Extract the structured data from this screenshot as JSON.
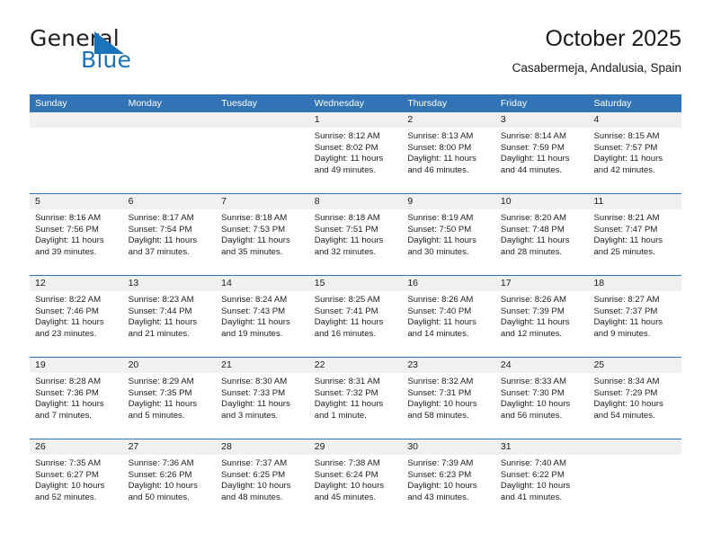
{
  "brand": {
    "name_part1": "General",
    "name_part2": "Blue",
    "triangle_color": "#1a74bb",
    "text_color": "#231f20"
  },
  "header": {
    "title": "October 2025",
    "subtitle": "Casabermeja, Andalusia, Spain"
  },
  "theme": {
    "accent": "#3273b5",
    "day_strip": "#f0f0f0",
    "text": "#1a1a1a"
  },
  "weekdays": [
    "Sunday",
    "Monday",
    "Tuesday",
    "Wednesday",
    "Thursday",
    "Friday",
    "Saturday"
  ],
  "labels": {
    "sunrise": "Sunrise:",
    "sunset": "Sunset:",
    "daylight": "Daylight:"
  },
  "weeks": [
    [
      {
        "day": "",
        "sunrise": "",
        "sunset": "",
        "daylight": "",
        "empty": true
      },
      {
        "day": "",
        "sunrise": "",
        "sunset": "",
        "daylight": "",
        "empty": true
      },
      {
        "day": "",
        "sunrise": "",
        "sunset": "",
        "daylight": "",
        "empty": true
      },
      {
        "day": "1",
        "sunrise": "Sunrise: 8:12 AM",
        "sunset": "Sunset: 8:02 PM",
        "daylight": "Daylight: 11 hours and 49 minutes."
      },
      {
        "day": "2",
        "sunrise": "Sunrise: 8:13 AM",
        "sunset": "Sunset: 8:00 PM",
        "daylight": "Daylight: 11 hours and 46 minutes."
      },
      {
        "day": "3",
        "sunrise": "Sunrise: 8:14 AM",
        "sunset": "Sunset: 7:59 PM",
        "daylight": "Daylight: 11 hours and 44 minutes."
      },
      {
        "day": "4",
        "sunrise": "Sunrise: 8:15 AM",
        "sunset": "Sunset: 7:57 PM",
        "daylight": "Daylight: 11 hours and 42 minutes."
      }
    ],
    [
      {
        "day": "5",
        "sunrise": "Sunrise: 8:16 AM",
        "sunset": "Sunset: 7:56 PM",
        "daylight": "Daylight: 11 hours and 39 minutes."
      },
      {
        "day": "6",
        "sunrise": "Sunrise: 8:17 AM",
        "sunset": "Sunset: 7:54 PM",
        "daylight": "Daylight: 11 hours and 37 minutes."
      },
      {
        "day": "7",
        "sunrise": "Sunrise: 8:18 AM",
        "sunset": "Sunset: 7:53 PM",
        "daylight": "Daylight: 11 hours and 35 minutes."
      },
      {
        "day": "8",
        "sunrise": "Sunrise: 8:18 AM",
        "sunset": "Sunset: 7:51 PM",
        "daylight": "Daylight: 11 hours and 32 minutes."
      },
      {
        "day": "9",
        "sunrise": "Sunrise: 8:19 AM",
        "sunset": "Sunset: 7:50 PM",
        "daylight": "Daylight: 11 hours and 30 minutes."
      },
      {
        "day": "10",
        "sunrise": "Sunrise: 8:20 AM",
        "sunset": "Sunset: 7:48 PM",
        "daylight": "Daylight: 11 hours and 28 minutes."
      },
      {
        "day": "11",
        "sunrise": "Sunrise: 8:21 AM",
        "sunset": "Sunset: 7:47 PM",
        "daylight": "Daylight: 11 hours and 25 minutes."
      }
    ],
    [
      {
        "day": "12",
        "sunrise": "Sunrise: 8:22 AM",
        "sunset": "Sunset: 7:46 PM",
        "daylight": "Daylight: 11 hours and 23 minutes."
      },
      {
        "day": "13",
        "sunrise": "Sunrise: 8:23 AM",
        "sunset": "Sunset: 7:44 PM",
        "daylight": "Daylight: 11 hours and 21 minutes."
      },
      {
        "day": "14",
        "sunrise": "Sunrise: 8:24 AM",
        "sunset": "Sunset: 7:43 PM",
        "daylight": "Daylight: 11 hours and 19 minutes."
      },
      {
        "day": "15",
        "sunrise": "Sunrise: 8:25 AM",
        "sunset": "Sunset: 7:41 PM",
        "daylight": "Daylight: 11 hours and 16 minutes."
      },
      {
        "day": "16",
        "sunrise": "Sunrise: 8:26 AM",
        "sunset": "Sunset: 7:40 PM",
        "daylight": "Daylight: 11 hours and 14 minutes."
      },
      {
        "day": "17",
        "sunrise": "Sunrise: 8:26 AM",
        "sunset": "Sunset: 7:39 PM",
        "daylight": "Daylight: 11 hours and 12 minutes."
      },
      {
        "day": "18",
        "sunrise": "Sunrise: 8:27 AM",
        "sunset": "Sunset: 7:37 PM",
        "daylight": "Daylight: 11 hours and 9 minutes."
      }
    ],
    [
      {
        "day": "19",
        "sunrise": "Sunrise: 8:28 AM",
        "sunset": "Sunset: 7:36 PM",
        "daylight": "Daylight: 11 hours and 7 minutes."
      },
      {
        "day": "20",
        "sunrise": "Sunrise: 8:29 AM",
        "sunset": "Sunset: 7:35 PM",
        "daylight": "Daylight: 11 hours and 5 minutes."
      },
      {
        "day": "21",
        "sunrise": "Sunrise: 8:30 AM",
        "sunset": "Sunset: 7:33 PM",
        "daylight": "Daylight: 11 hours and 3 minutes."
      },
      {
        "day": "22",
        "sunrise": "Sunrise: 8:31 AM",
        "sunset": "Sunset: 7:32 PM",
        "daylight": "Daylight: 11 hours and 1 minute."
      },
      {
        "day": "23",
        "sunrise": "Sunrise: 8:32 AM",
        "sunset": "Sunset: 7:31 PM",
        "daylight": "Daylight: 10 hours and 58 minutes."
      },
      {
        "day": "24",
        "sunrise": "Sunrise: 8:33 AM",
        "sunset": "Sunset: 7:30 PM",
        "daylight": "Daylight: 10 hours and 56 minutes."
      },
      {
        "day": "25",
        "sunrise": "Sunrise: 8:34 AM",
        "sunset": "Sunset: 7:29 PM",
        "daylight": "Daylight: 10 hours and 54 minutes."
      }
    ],
    [
      {
        "day": "26",
        "sunrise": "Sunrise: 7:35 AM",
        "sunset": "Sunset: 6:27 PM",
        "daylight": "Daylight: 10 hours and 52 minutes."
      },
      {
        "day": "27",
        "sunrise": "Sunrise: 7:36 AM",
        "sunset": "Sunset: 6:26 PM",
        "daylight": "Daylight: 10 hours and 50 minutes."
      },
      {
        "day": "28",
        "sunrise": "Sunrise: 7:37 AM",
        "sunset": "Sunset: 6:25 PM",
        "daylight": "Daylight: 10 hours and 48 minutes."
      },
      {
        "day": "29",
        "sunrise": "Sunrise: 7:38 AM",
        "sunset": "Sunset: 6:24 PM",
        "daylight": "Daylight: 10 hours and 45 minutes."
      },
      {
        "day": "30",
        "sunrise": "Sunrise: 7:39 AM",
        "sunset": "Sunset: 6:23 PM",
        "daylight": "Daylight: 10 hours and 43 minutes."
      },
      {
        "day": "31",
        "sunrise": "Sunrise: 7:40 AM",
        "sunset": "Sunset: 6:22 PM",
        "daylight": "Daylight: 10 hours and 41 minutes."
      },
      {
        "day": "",
        "sunrise": "",
        "sunset": "",
        "daylight": "",
        "empty": true
      }
    ]
  ]
}
